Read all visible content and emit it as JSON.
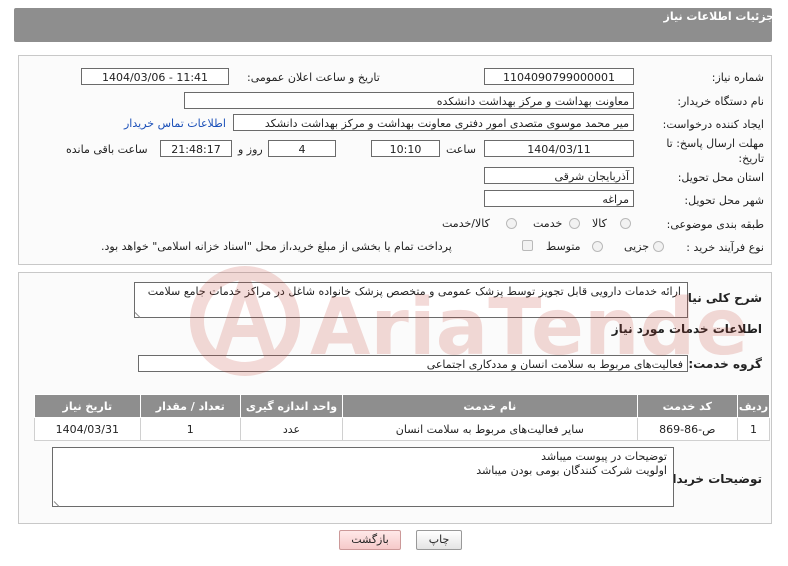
{
  "panel": {
    "title": "جزئیات اطلاعات نیاز"
  },
  "form": {
    "need_number_label": "شماره نیاز:",
    "need_number": "1104090799000001",
    "announce_label": "تاریخ و ساعت اعلان عمومی:",
    "announce_value": "1404/03/06 - 11:41",
    "buyer_org_label": "نام دستگاه خریدار:",
    "buyer_org": "معاونت بهداشت و مرکز بهداشت دانشکده",
    "creator_label": "ایجاد کننده درخواست:",
    "creator": "میر محمد موسوی متصدی امور دفتری معاونت بهداشت و مرکز بهداشت دانشکد",
    "contact_link": "اطلاعات تماس خریدار",
    "deadline_label": "مهلت ارسال پاسخ: تا تاریخ:",
    "deadline_date": "1404/03/11",
    "time_label": "ساعت",
    "deadline_time": "10:10",
    "days_value": "4",
    "days_label": "روز و",
    "remaining_time": "21:48:17",
    "remaining_label": "ساعت باقی مانده",
    "province_label": "استان محل تحویل:",
    "province": "آذربایجان شرقی",
    "city_label": "شهر محل تحویل:",
    "city": "مراغه",
    "category_label": "طبقه بندی موضوعی:",
    "category_options": [
      "کالا",
      "خدمت",
      "کالا/خدمت"
    ],
    "category_selected": "خدمت",
    "process_label": "نوع فرآیند خرید :",
    "process_options": [
      "جزیی",
      "متوسط"
    ],
    "payment_note": "پرداخت تمام یا بخشی از مبلغ خرید،از محل \"اسناد خزانه اسلامی\" خواهد بود."
  },
  "details": {
    "desc_label": "شرح کلی نیاز:",
    "desc_text": "ارائه خدمات دارویی قابل تجویز توسط پزشک عمومی و متخصص پزشک خانواده شاغل در مراکز خدمات جامع سلامت",
    "services_heading": "اطلاعات خدمات مورد نیاز",
    "service_group_label": "گروه خدمت:",
    "service_group": "فعالیت‌های مربوط به سلامت انسان و مددکاری اجتماعی"
  },
  "table": {
    "headers": [
      "ردیف",
      "کد خدمت",
      "نام خدمت",
      "واحد اندازه گیری",
      "تعداد / مقدار",
      "تاریخ نیاز"
    ],
    "rows": [
      [
        "1",
        "ص-86-869",
        "سایر فعالیت‌های مربوط به سلامت انسان",
        "عدد",
        "1",
        "1404/03/31"
      ]
    ]
  },
  "buyer_notes": {
    "label": "توضیحات خریدار:",
    "line1": "توضیحات در پیوست میباشد",
    "line2": "اولویت شرکت کنندگان بومی بودن میباشد"
  },
  "buttons": {
    "print": "چاپ",
    "back": "بازگشت"
  },
  "watermark": {
    "text": "AriaTender.neT"
  },
  "colors": {
    "header_bg": "#8e8e8e",
    "link": "#1a4fb8",
    "watermark": "#c0392b"
  }
}
